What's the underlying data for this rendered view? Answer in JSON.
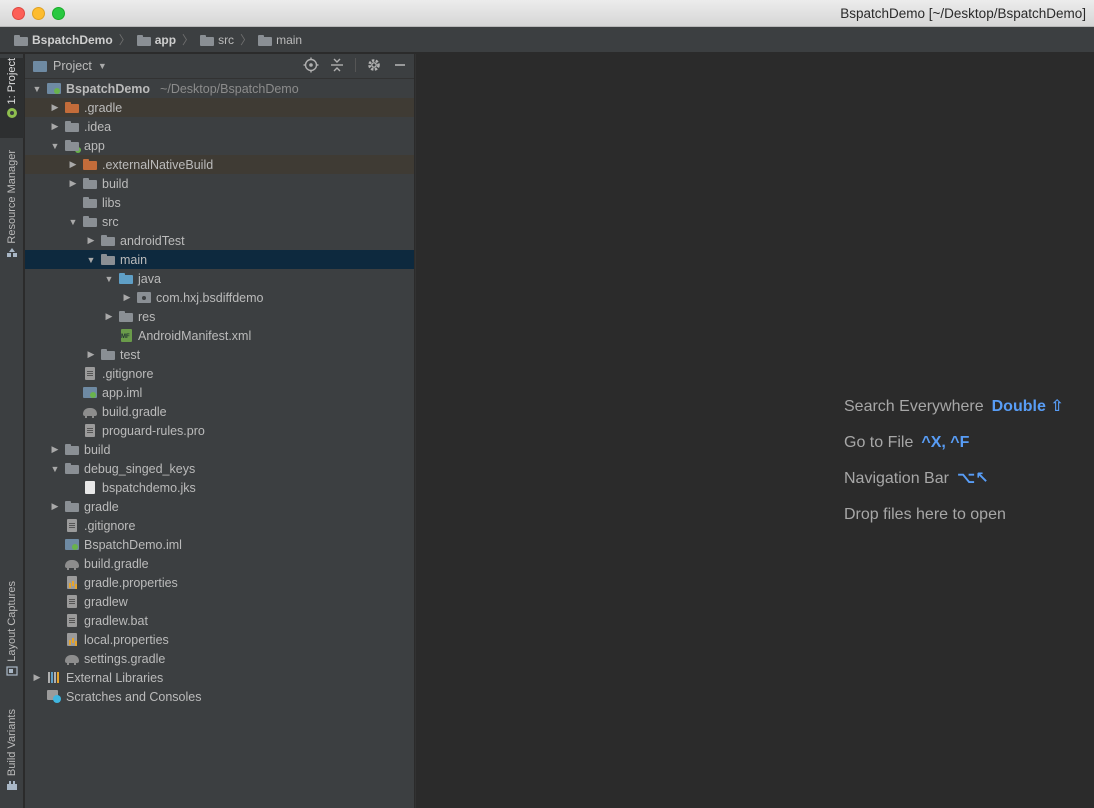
{
  "window": {
    "title": "BspatchDemo [~/Desktop/BspatchDemo]"
  },
  "breadcrumbs": [
    "BspatchDemo",
    "app",
    "src",
    "main"
  ],
  "left_tool_tabs": {
    "project": "1: Project",
    "resource_manager": "Resource Manager",
    "layout_captures": "Layout Captures",
    "build_variants": "Build Variants"
  },
  "panel": {
    "title": "Project"
  },
  "tree": [
    {
      "label": "BspatchDemo",
      "hint": "~/Desktop/BspatchDemo",
      "depth": 0,
      "expanded": true,
      "icon": "module"
    },
    {
      "label": ".gradle",
      "depth": 1,
      "expanded": false,
      "icon": "folder-orange",
      "excluded": true
    },
    {
      "label": ".idea",
      "depth": 1,
      "expanded": false,
      "icon": "folder"
    },
    {
      "label": "app",
      "depth": 1,
      "expanded": true,
      "icon": "folder-module"
    },
    {
      "label": ".externalNativeBuild",
      "depth": 2,
      "expanded": false,
      "icon": "folder-orange",
      "excluded": true
    },
    {
      "label": "build",
      "depth": 2,
      "expanded": false,
      "icon": "folder"
    },
    {
      "label": "libs",
      "depth": 2,
      "leaf": true,
      "icon": "folder"
    },
    {
      "label": "src",
      "depth": 2,
      "expanded": true,
      "icon": "folder"
    },
    {
      "label": "androidTest",
      "depth": 3,
      "expanded": false,
      "icon": "folder"
    },
    {
      "label": "main",
      "depth": 3,
      "expanded": true,
      "icon": "folder",
      "selected": true
    },
    {
      "label": "java",
      "depth": 4,
      "expanded": true,
      "icon": "folder-blue"
    },
    {
      "label": "com.hxj.bsdiffdemo",
      "depth": 5,
      "expanded": false,
      "icon": "package"
    },
    {
      "label": "res",
      "depth": 4,
      "expanded": false,
      "icon": "folder"
    },
    {
      "label": "AndroidManifest.xml",
      "depth": 4,
      "leaf": true,
      "icon": "manifest"
    },
    {
      "label": "test",
      "depth": 3,
      "expanded": false,
      "icon": "folder"
    },
    {
      "label": ".gitignore",
      "depth": 2,
      "leaf": true,
      "icon": "file"
    },
    {
      "label": "app.iml",
      "depth": 2,
      "leaf": true,
      "icon": "iml"
    },
    {
      "label": "build.gradle",
      "depth": 2,
      "leaf": true,
      "icon": "gradle"
    },
    {
      "label": "proguard-rules.pro",
      "depth": 2,
      "leaf": true,
      "icon": "file"
    },
    {
      "label": "build",
      "depth": 1,
      "expanded": false,
      "icon": "folder"
    },
    {
      "label": "debug_singed_keys",
      "depth": 1,
      "expanded": true,
      "icon": "folder"
    },
    {
      "label": "bspatchdemo.jks",
      "depth": 2,
      "leaf": true,
      "icon": "file-white"
    },
    {
      "label": "gradle",
      "depth": 1,
      "expanded": false,
      "icon": "folder"
    },
    {
      "label": ".gitignore",
      "depth": 1,
      "leaf": true,
      "icon": "file"
    },
    {
      "label": "BspatchDemo.iml",
      "depth": 1,
      "leaf": true,
      "icon": "iml"
    },
    {
      "label": "build.gradle",
      "depth": 1,
      "leaf": true,
      "icon": "gradle"
    },
    {
      "label": "gradle.properties",
      "depth": 1,
      "leaf": true,
      "icon": "properties"
    },
    {
      "label": "gradlew",
      "depth": 1,
      "leaf": true,
      "icon": "file"
    },
    {
      "label": "gradlew.bat",
      "depth": 1,
      "leaf": true,
      "icon": "file"
    },
    {
      "label": "local.properties",
      "depth": 1,
      "leaf": true,
      "icon": "properties"
    },
    {
      "label": "settings.gradle",
      "depth": 1,
      "leaf": true,
      "icon": "gradle"
    },
    {
      "label": "External Libraries",
      "depth": 0,
      "expanded": false,
      "icon": "libraries"
    },
    {
      "label": "Scratches and Consoles",
      "depth": 0,
      "leaf": true,
      "icon": "scratch"
    }
  ],
  "editor_tips": [
    {
      "text": "Search Everywhere",
      "shortcut": "Double ⇧"
    },
    {
      "text": "Go to File",
      "shortcut": "^X, ^F"
    },
    {
      "text": "Navigation Bar",
      "shortcut": "⌥↖"
    },
    {
      "text": "Drop files here to open",
      "shortcut": ""
    }
  ],
  "colors": {
    "selection": "#0d293e",
    "excluded_row": "#3f3b34",
    "shortcut": "#589df6"
  }
}
